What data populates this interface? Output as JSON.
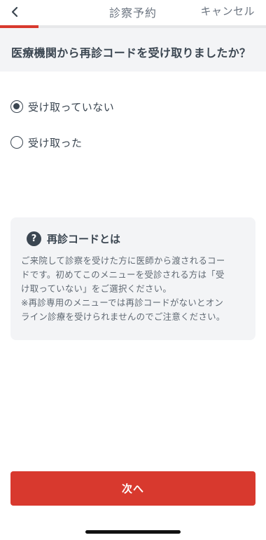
{
  "header": {
    "title": "診察予約",
    "cancel_label": "キャンセル",
    "back_icon": "chevron-left-icon"
  },
  "progress": {
    "fraction": 0.145,
    "color": "#d8392e"
  },
  "question": "医療機関から再診コードを受け取りましたか？",
  "options": [
    {
      "label": "受け取っていない",
      "selected": true
    },
    {
      "label": "受け取った",
      "selected": false
    }
  ],
  "info": {
    "icon": "question-circle-icon",
    "title": "再診コードとは",
    "lines": [
      "ご来院して診察を受けた方に医師から渡されるコー",
      "ドです。初めてこのメニューを受診される方は「受",
      "け取っていない」をご選択ください。",
      "※再診専用のメニューでは再診コードがないとオン",
      "ライン診療を受けられませんのでご注意ください。"
    ]
  },
  "next_label": "次へ",
  "colors": {
    "accent": "#d8392e",
    "text_dark": "#3b4651",
    "panel_bg": "#f3f4f6"
  }
}
